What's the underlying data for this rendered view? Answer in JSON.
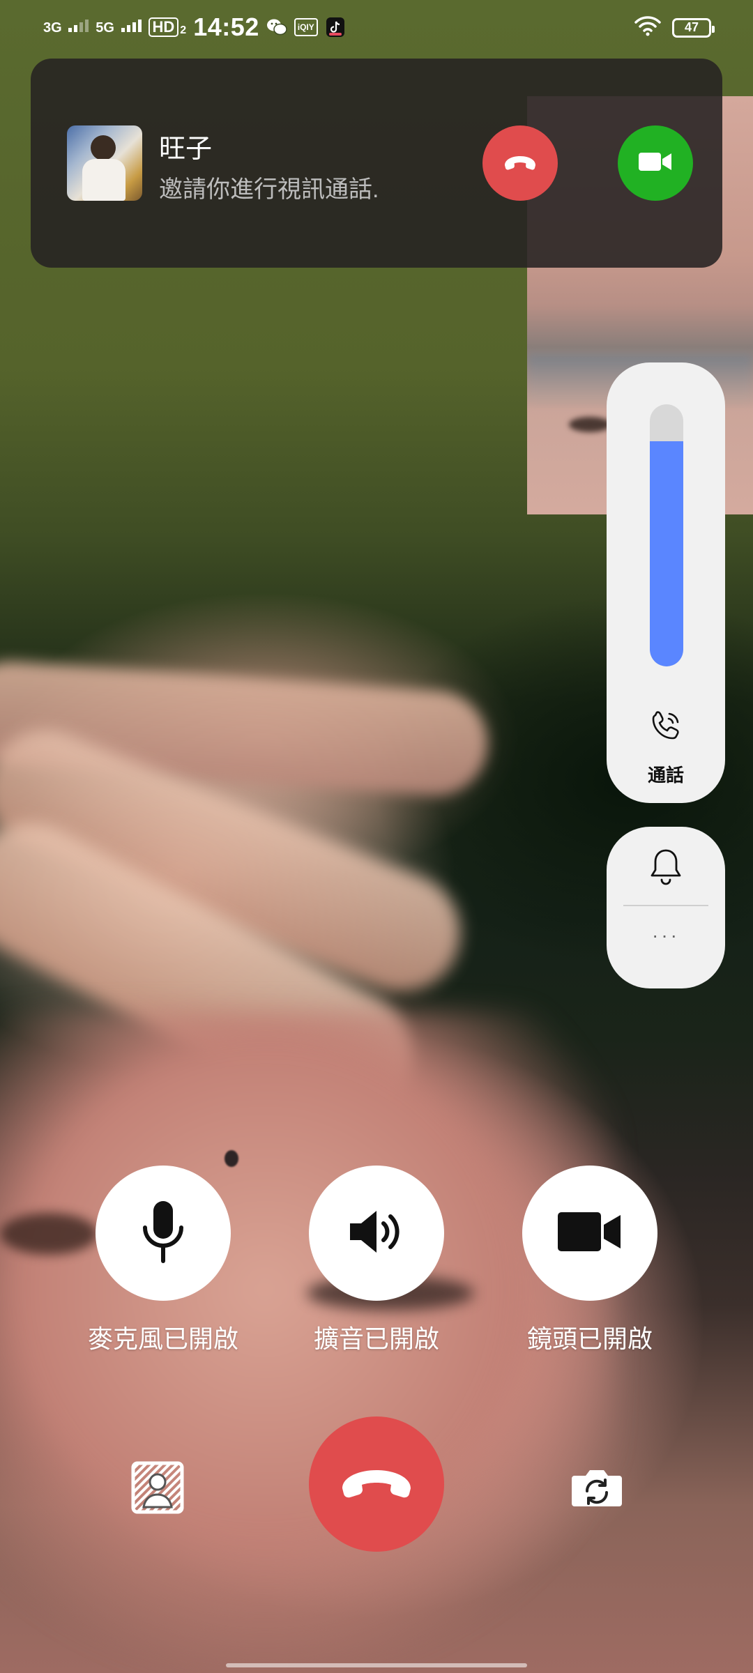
{
  "status_bar": {
    "network1": "3G",
    "network2": "5G",
    "hd": "HD",
    "hd_sub": "2",
    "time": "14:52",
    "app_icon_iqiyi": "iQIY",
    "battery": "47"
  },
  "incoming_call": {
    "caller_name": "旺子",
    "message": "邀請你進行視訊通話.",
    "decline_color": "#e04c4d",
    "accept_color": "#21b123"
  },
  "volume_panel": {
    "level_fraction": 0.86,
    "label": "通話",
    "accent_color": "#5a86ff"
  },
  "mode_panel": {
    "more_label": "···"
  },
  "controls": {
    "mic_label": "麥克風已開啟",
    "speaker_label": "擴音已開啟",
    "camera_label": "鏡頭已開啟"
  },
  "bottom": {
    "end_call_color": "#e04c4d"
  }
}
